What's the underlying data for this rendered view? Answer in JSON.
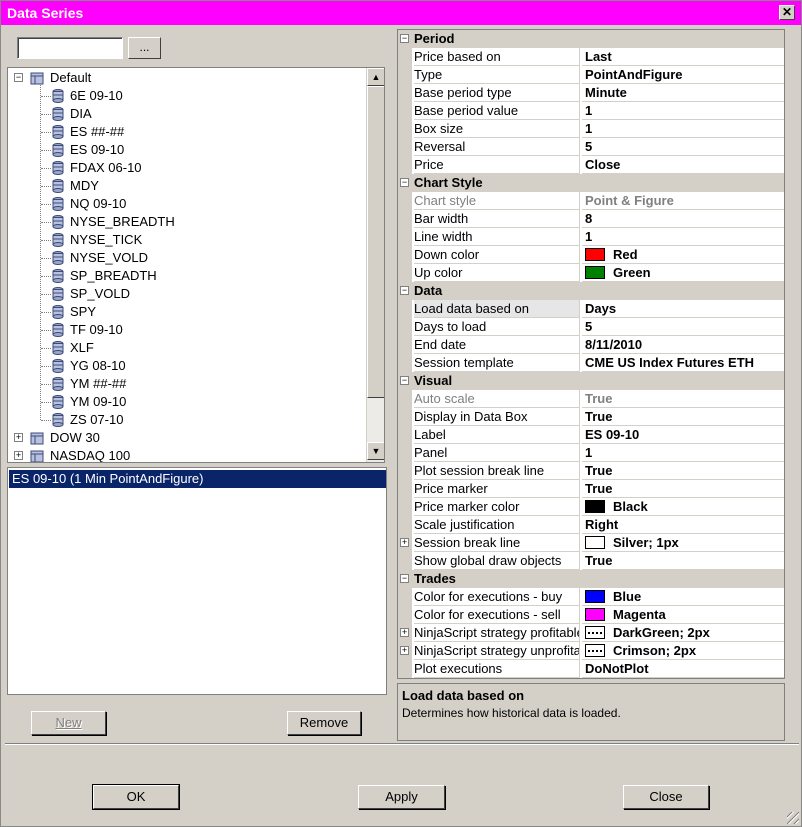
{
  "window": {
    "title": "Data Series",
    "close_glyph": "✕"
  },
  "search": {
    "value": "",
    "placeholder": "",
    "browse_label": "..."
  },
  "tree": {
    "groups": [
      {
        "label": "Default",
        "expanded": true,
        "items": [
          "6E 09-10",
          "DIA",
          "ES ##-##",
          "ES 09-10",
          "FDAX 06-10",
          "MDY",
          "NQ 09-10",
          "NYSE_BREADTH",
          "NYSE_TICK",
          "NYSE_VOLD",
          "SP_BREADTH",
          "SP_VOLD",
          "SPY",
          "TF 09-10",
          "XLF",
          "YG 08-10",
          "YM ##-##",
          "YM 09-10",
          "ZS 07-10"
        ]
      },
      {
        "label": "DOW 30",
        "expanded": false,
        "items": []
      },
      {
        "label": "NASDAQ 100",
        "expanded": false,
        "items": []
      }
    ],
    "expand_glyph": "−",
    "collapse_glyph": "+",
    "scroll_up": "▲",
    "scroll_down": "▼"
  },
  "series": {
    "selected": "ES 09-10 (1 Min PointAndFigure)"
  },
  "buttons": {
    "new": "New",
    "remove": "Remove",
    "ok": "OK",
    "apply": "Apply",
    "close": "Close"
  },
  "grid": {
    "categories": [
      {
        "name": "Period",
        "props": [
          {
            "name": "Price based on",
            "value": "Last"
          },
          {
            "name": "Type",
            "value": "PointAndFigure"
          },
          {
            "name": "Base period type",
            "value": "Minute"
          },
          {
            "name": "Base period value",
            "value": "1"
          },
          {
            "name": "Box size",
            "value": "1"
          },
          {
            "name": "Reversal",
            "value": "5"
          },
          {
            "name": "Price",
            "value": "Close"
          }
        ]
      },
      {
        "name": "Chart Style",
        "props": [
          {
            "name": "Chart style",
            "value": "Point & Figure",
            "readonly": true
          },
          {
            "name": "Bar width",
            "value": "8"
          },
          {
            "name": "Line width",
            "value": "1"
          },
          {
            "name": "Down color",
            "value": "Red",
            "swatch": "#ff0000"
          },
          {
            "name": "Up color",
            "value": "Green",
            "swatch": "#008000"
          }
        ]
      },
      {
        "name": "Data",
        "props": [
          {
            "name": "Load data based on",
            "value": "Days",
            "selected": true
          },
          {
            "name": "Days to load",
            "value": "5"
          },
          {
            "name": "End date",
            "value": "8/11/2010"
          },
          {
            "name": "Session template",
            "value": "CME US Index Futures ETH"
          }
        ]
      },
      {
        "name": "Visual",
        "props": [
          {
            "name": "Auto scale",
            "value": "True",
            "readonly": true
          },
          {
            "name": "Display in Data Box",
            "value": "True"
          },
          {
            "name": "Label",
            "value": "ES 09-10"
          },
          {
            "name": "Panel",
            "value": "1"
          },
          {
            "name": "Plot session break line",
            "value": "True"
          },
          {
            "name": "Price marker",
            "value": "True"
          },
          {
            "name": "Price marker color",
            "value": "Black",
            "swatch": "#000000"
          },
          {
            "name": "Scale justification",
            "value": "Right"
          },
          {
            "name": "Session break line",
            "value": "Silver; 1px",
            "swatch": "#ffffff",
            "expandable": true
          },
          {
            "name": "Show global draw objects",
            "value": "True"
          }
        ]
      },
      {
        "name": "Trades",
        "props": [
          {
            "name": "Color for executions - buy",
            "value": "Blue",
            "swatch": "#0000ff"
          },
          {
            "name": "Color for executions - sell",
            "value": "Magenta",
            "swatch": "#ff00ff"
          },
          {
            "name": "NinjaScript strategy profitable",
            "value": "DarkGreen; 2px",
            "swatch": "dots",
            "expandable": true
          },
          {
            "name": "NinjaScript strategy unprofitable",
            "value": "Crimson; 2px",
            "swatch": "dots",
            "expandable": true
          },
          {
            "name": "Plot executions",
            "value": "DoNotPlot"
          }
        ]
      }
    ],
    "expand_glyph": "−",
    "collapse_glyph": "+"
  },
  "description": {
    "title": "Load data based on",
    "text": "Determines how historical data is loaded."
  }
}
